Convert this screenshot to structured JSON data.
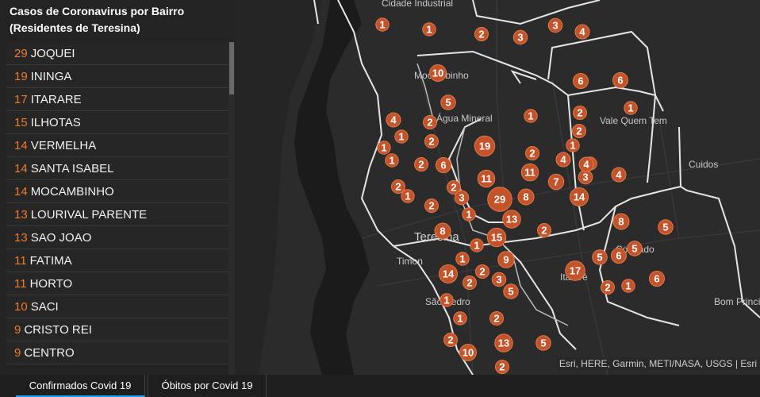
{
  "panel": {
    "title": "Casos de Coronavirus por Bairro (Residentes de Teresina)",
    "items": [
      {
        "count": "29",
        "name": "JOQUEI"
      },
      {
        "count": "19",
        "name": "ININGA"
      },
      {
        "count": "17",
        "name": "ITARARE"
      },
      {
        "count": "15",
        "name": "ILHOTAS"
      },
      {
        "count": "14",
        "name": "VERMELHA"
      },
      {
        "count": "14",
        "name": "SANTA ISABEL"
      },
      {
        "count": "14",
        "name": "MOCAMBINHO"
      },
      {
        "count": "13",
        "name": "LOURIVAL PARENTE"
      },
      {
        "count": "13",
        "name": "SAO JOAO"
      },
      {
        "count": "11",
        "name": "FATIMA"
      },
      {
        "count": "11",
        "name": "HORTO"
      },
      {
        "count": "10",
        "name": "SACI"
      },
      {
        "count": "9",
        "name": "CRISTO REI"
      },
      {
        "count": "9",
        "name": "CENTRO"
      }
    ]
  },
  "map": {
    "labels": {
      "cidade_industrial": "Cidade Industrial",
      "mocambinho": "Mocambinho",
      "agua_mineral": "Água Mineral",
      "vale_quem_tem": "Vale Quem Tem",
      "cuidos": "Cuidos",
      "teresina": "Teresina",
      "timon": "Timon",
      "colorado": "Colorado",
      "itarare": "Itararé",
      "sao_pedro": "São Pedro",
      "bom_principio": "Bom Princípio"
    },
    "attribution": "Esri, HERE, Garmin, METI/NASA, USGS | Esri",
    "marker_values": [
      "1",
      "1",
      "2",
      "3",
      "3",
      "4",
      "10",
      "6",
      "6",
      "5",
      "1",
      "4",
      "2",
      "1",
      "2",
      "1",
      "2",
      "2",
      "1",
      "1",
      "1",
      "1",
      "19",
      "2",
      "4",
      "1",
      "4",
      "3",
      "6",
      "2",
      "11",
      "11",
      "7",
      "4",
      "2",
      "1",
      "2",
      "3",
      "29",
      "8",
      "14",
      "2",
      "13",
      "1",
      "2",
      "15",
      "1",
      "8",
      "5",
      "9",
      "14",
      "1",
      "2",
      "2",
      "3",
      "5",
      "6",
      "17",
      "5",
      "5",
      "6",
      "2",
      "1",
      "1",
      "1",
      "2",
      "2",
      "10",
      "13",
      "5",
      "2",
      "8"
    ],
    "colors": {
      "marker": "#c4532a",
      "boundary": "#e6e6e6",
      "highlight": "#f07a2a"
    }
  },
  "tabs": [
    {
      "label": "Confirmados Covid 19"
    },
    {
      "label": "Óbitos por Covid 19"
    }
  ]
}
